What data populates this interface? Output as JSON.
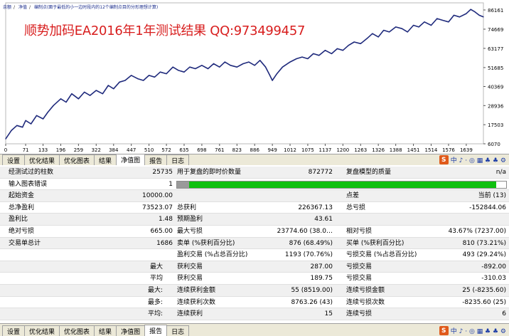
{
  "colors": {
    "equity_line": "#1f2a7c",
    "accent_green": "#10c010",
    "watermark": "#d81e1e"
  },
  "legend": {
    "items": [
      "余额",
      "净值",
      "编制点(面于最低的小一边时段内的12个编制点目的分形理想计算)"
    ]
  },
  "watermark": "顺势加码EA2016年1年测试结果    QQ:973499457",
  "chart_data": {
    "type": "line",
    "title": "",
    "x_ticks": [
      "0",
      "71",
      "133",
      "196",
      "259",
      "322",
      "384",
      "447",
      "510",
      "572",
      "635",
      "698",
      "761",
      "823",
      "886",
      "949",
      "1012",
      "1075",
      "1137",
      "1200",
      "1263",
      "1326",
      "1388",
      "1451",
      "1514",
      "1576",
      "1639"
    ],
    "y_ticks": [
      "86161",
      "74669",
      "63177",
      "51685",
      "40369",
      "28936",
      "17503",
      "6070"
    ],
    "ylim": [
      6070,
      86161
    ],
    "xlim": [
      0,
      1700
    ],
    "series": [
      {
        "x": [
          0,
          20,
          40,
          60,
          71,
          90,
          110,
          133,
          150,
          170,
          196,
          215,
          235,
          259,
          280,
          300,
          322,
          345,
          365,
          384,
          405,
          425,
          447,
          470,
          490,
          510,
          530,
          550,
          572,
          595,
          615,
          635,
          655,
          675,
          698,
          720,
          740,
          761,
          780,
          800,
          823,
          845,
          865,
          886,
          905,
          925,
          940,
          949,
          965,
          985,
          1012,
          1035,
          1055,
          1075,
          1095,
          1115,
          1137,
          1160,
          1180,
          1200,
          1220,
          1240,
          1263,
          1285,
          1305,
          1326,
          1345,
          1365,
          1388,
          1410,
          1430,
          1451,
          1470,
          1490,
          1514,
          1535,
          1555,
          1576,
          1595,
          1615,
          1639,
          1655,
          1670,
          1685,
          1700
        ],
        "values": [
          9000,
          14000,
          17000,
          16000,
          20000,
          18000,
          23000,
          21000,
          25000,
          29000,
          33000,
          31000,
          36000,
          33000,
          37000,
          35000,
          38000,
          36000,
          41000,
          39000,
          43000,
          44000,
          47000,
          45000,
          44000,
          47000,
          46000,
          49000,
          48000,
          52000,
          50000,
          49000,
          52000,
          51000,
          53000,
          51000,
          54000,
          52000,
          55000,
          53000,
          52000,
          54000,
          55000,
          53000,
          56000,
          52000,
          47000,
          44000,
          48000,
          52000,
          55000,
          57000,
          58000,
          57000,
          60000,
          59000,
          62000,
          60000,
          63000,
          62000,
          65000,
          67000,
          66000,
          69000,
          72000,
          70000,
          74000,
          73000,
          76000,
          75000,
          73000,
          77000,
          76000,
          79000,
          77000,
          81000,
          80000,
          79000,
          83000,
          82000,
          84000,
          86500,
          85000,
          83000,
          82000
        ]
      }
    ]
  },
  "chart_tabs": [
    "设置",
    "优化结果",
    "优化图表",
    "结果",
    "净值图",
    "报告",
    "日志"
  ],
  "chart_tab_active": 4,
  "bottom_tabs": [
    "设置",
    "优化结果",
    "优化图表",
    "结果",
    "净值图",
    "报告",
    "日志"
  ],
  "bottom_tab_active": 5,
  "ime": {
    "badge": "S",
    "text": "中 ♪ · ◎ ▦ ♣ ♣ ⚙"
  },
  "report": {
    "rows": [
      {
        "l1": "经测试过的柱数",
        "v1": "25735",
        "l2": "用于复盘的即时价数量",
        "v2": "872772",
        "l3": "复盘模型的质量",
        "v3": "n/a",
        "shaded": true
      },
      {
        "l1": "输入图表错误",
        "v1": "1",
        "progress": true,
        "progress_value": "97%",
        "shaded": false
      },
      {
        "l1": "起始资金",
        "v1": "10000.00",
        "l2": "",
        "v2": "",
        "l3": "点差",
        "v3": "当前 (13)",
        "shaded": true
      },
      {
        "l1": "总净盈利",
        "v1": "73523.07",
        "l2": "总获利",
        "v2": "226367.13",
        "l3": "总亏损",
        "v3": "-152844.06",
        "shaded": false
      },
      {
        "l1": "盈利比",
        "v1": "1.48",
        "l2": "预期盈利",
        "v2": "43.61",
        "l3": "",
        "v3": "",
        "shaded": true
      },
      {
        "l1": "绝对亏损",
        "v1": "665.00",
        "l2": "最大亏损",
        "v2": "23774.60 (38.0…",
        "l3": "相对亏损",
        "v3": "43.67% (7237.00)",
        "shaded": false
      },
      {
        "l1": "交易单总计",
        "v1": "1686",
        "l2": "卖单 (%获利百分比)",
        "v2": "876 (68.49%)",
        "l3": "买单 (%获利百分比)",
        "v3": "810 (73.21%)",
        "shaded": true
      },
      {
        "l1": "",
        "v1": "",
        "l2": "盈利交易 (%占总百分比)",
        "v2": "1193 (70.76%)",
        "l3": "亏损交易 (%占总百分比)",
        "v3": "493 (29.24%)",
        "shaded": false
      },
      {
        "r1": "最大",
        "l2": "获利交易",
        "v2": "287.00",
        "l3": "亏损交易",
        "v3": "-892.00",
        "shaded": true
      },
      {
        "r1": "平均",
        "l2": "获利交易",
        "v2": "189.75",
        "l3": "亏损交易",
        "v3": "-310.03",
        "shaded": false
      },
      {
        "r1": "最大:",
        "l2": "连续获利金额",
        "v2": "55 (8519.00)",
        "l3": "连续亏损金额",
        "v3": "25 (-8235.60)",
        "shaded": true
      },
      {
        "r1": "最多:",
        "l2": "连续获利次数",
        "v2": "8763.26 (43)",
        "l3": "连续亏损次数",
        "v3": "-8235.60 (25)",
        "shaded": false
      },
      {
        "r1": "平均:",
        "l2": "连续获利",
        "v2": "15",
        "l3": "连续亏损",
        "v3": "6",
        "shaded": true
      }
    ]
  }
}
